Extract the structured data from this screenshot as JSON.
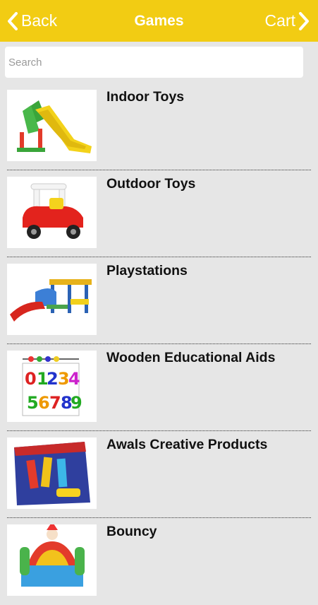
{
  "header": {
    "back_label": "Back",
    "title": "Games",
    "cart_label": "Cart"
  },
  "search": {
    "placeholder": "Search",
    "value": ""
  },
  "categories": [
    {
      "label": "Indoor Toys",
      "icon": "slide-image"
    },
    {
      "label": "Outdoor Toys",
      "icon": "ride-on-car-image"
    },
    {
      "label": "Playstations",
      "icon": "playground-image"
    },
    {
      "label": "Wooden Educational Aids",
      "icon": "number-board-image"
    },
    {
      "label": "Awals Creative Products",
      "icon": "game-box-image"
    },
    {
      "label": "Bouncy",
      "icon": "bouncy-castle-image"
    }
  ],
  "colors": {
    "header_bg": "#f2cc13",
    "page_bg": "#e6e6e6",
    "header_text": "#ffffff"
  }
}
